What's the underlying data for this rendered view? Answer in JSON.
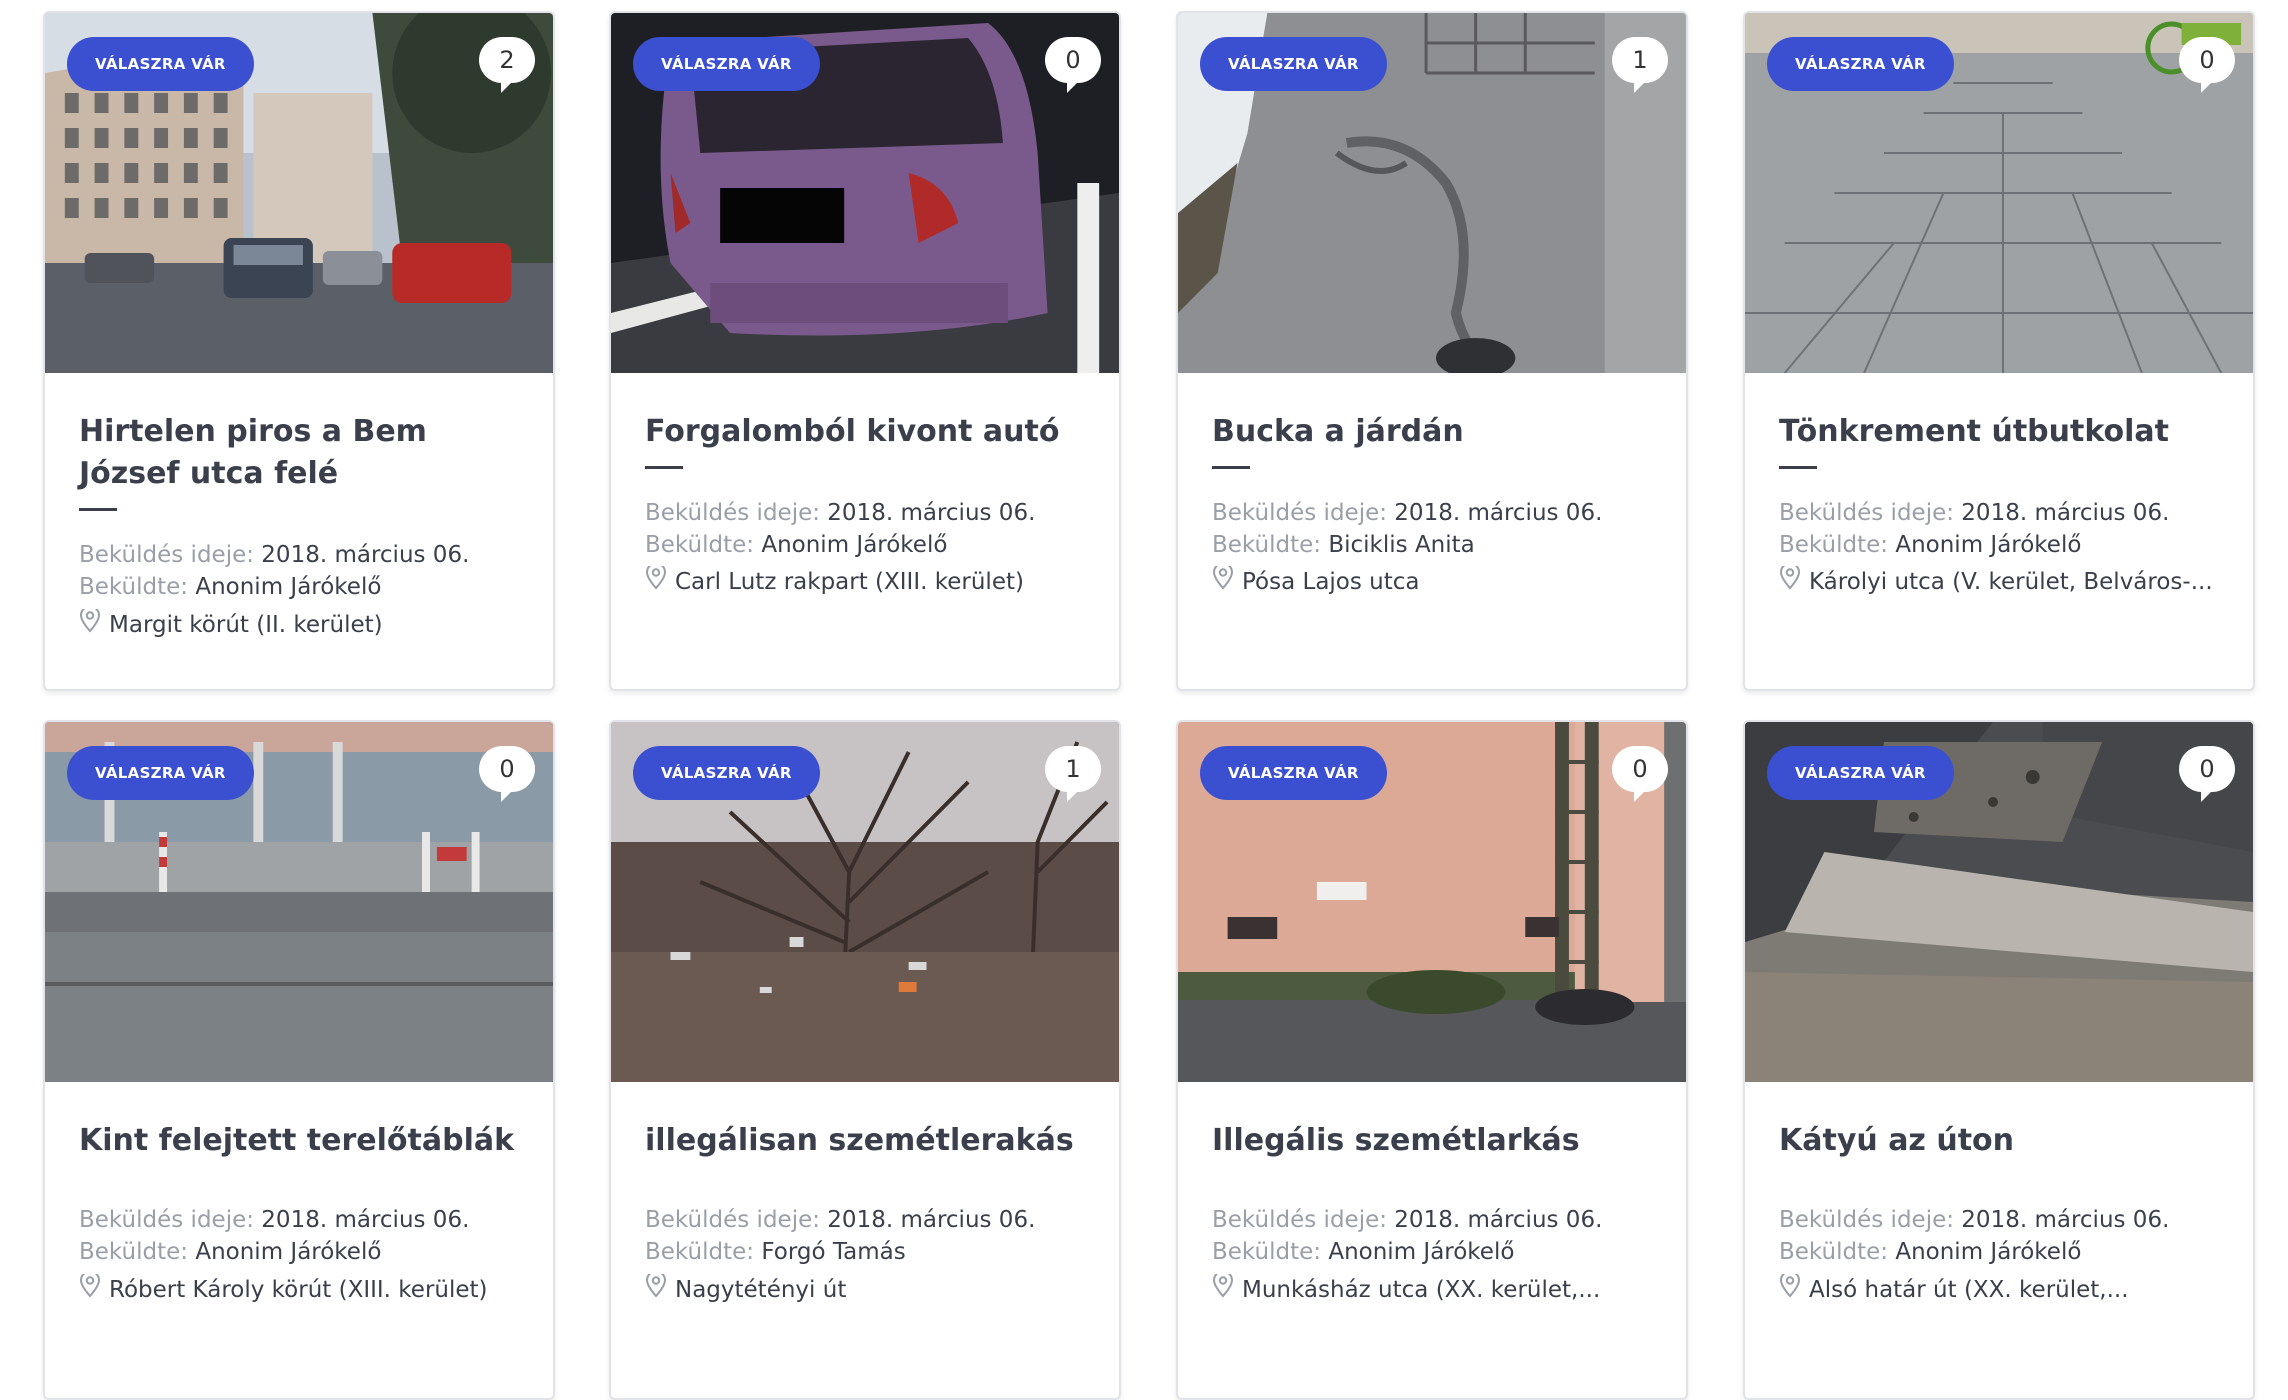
{
  "labels": {
    "status": "VÁLASZRA VÁR",
    "sent_at": "Beküldés ideje:",
    "sent_by": "Beküldte:"
  },
  "cards": [
    {
      "title": "Hirtelen piros a Bem József utca felé",
      "comments": "2",
      "date": "2018. március 06.",
      "author": "Anonim Járókelő",
      "location": "Margit körút (II. kerület)"
    },
    {
      "title": "Forgalomból kivont autó",
      "comments": "0",
      "date": "2018. március 06.",
      "author": "Anonim Járókelő",
      "location": "Carl Lutz rakpart (XIII. kerület)"
    },
    {
      "title": "Bucka a járdán",
      "comments": "1",
      "date": "2018. március 06.",
      "author": "Biciklis Anita",
      "location": "Pósa Lajos utca"
    },
    {
      "title": "Tönkrement útbutkolat",
      "comments": "0",
      "date": "2018. március 06.",
      "author": "Anonim Járókelő",
      "location": "Károlyi utca (V. kerület, Belváros-..."
    },
    {
      "title": "Kint felejtett terelőtáblák",
      "comments": "0",
      "date": "2018. március 06.",
      "author": "Anonim Járókelő",
      "location": "Róbert Károly körút (XIII. kerület)"
    },
    {
      "title": "illegálisan szemétlerakás",
      "comments": "1",
      "date": "2018. március 06.",
      "author": "Forgó Tamás",
      "location": "Nagytétényi út"
    },
    {
      "title": "Illegális szemétlarkás",
      "comments": "0",
      "date": "2018. március 06.",
      "author": "Anonim Járókelő",
      "location": "Munkásház utca (XX. kerület,..."
    },
    {
      "title": "Kátyú az úton",
      "comments": "0",
      "date": "2018. március 06.",
      "author": "Anonim Járókelő",
      "location": "Alsó határ út (XX. kerület,..."
    }
  ],
  "colors": {
    "status_bg": "#3b4fd1",
    "title": "#3a3f4b",
    "label": "#9a9ea7"
  },
  "icons": {
    "location": "map-pin-icon",
    "comments": "speech-bubble-icon"
  }
}
